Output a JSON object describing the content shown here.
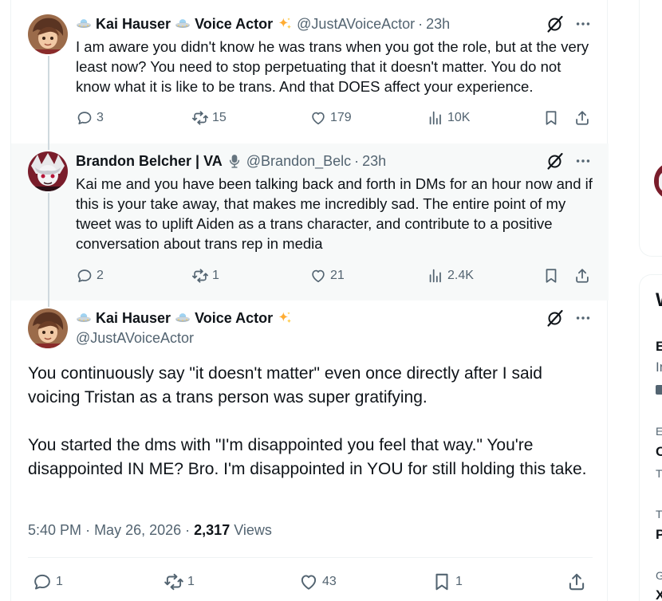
{
  "tweets": [
    {
      "display_name": "Kai Hauser",
      "badge": "Voice Actor",
      "handle": "@JustAVoiceActor",
      "time": "23h",
      "text": "I am aware you didn't know he was trans when you got the role, but at the very least now? You need to stop perpetuating that it doesn't matter. You do not know what it is like to be trans. And that DOES affect your experience.",
      "replies": "3",
      "reposts": "15",
      "likes": "179",
      "views": "10K"
    },
    {
      "display_name": "Brandon Belcher | VA",
      "handle": "@Brandon_Belc",
      "time": "23h",
      "text": "Kai me and you have been talking back and forth in DMs for an hour now and if this is your take away, that makes me incredibly sad. The entire point of my tweet was to uplift Aiden as a trans character, and contribute to a positive conversation about trans rep in media",
      "replies": "2",
      "reposts": "1",
      "likes": "21",
      "views": "2.4K"
    }
  ],
  "main_tweet": {
    "display_name": "Kai Hauser",
    "badge": "Voice Actor",
    "handle": "@JustAVoiceActor",
    "paragraph1": "You continuously say \"it doesn't matter\" even once directly after I said voicing Tristan as a trans person was super gratifying.",
    "paragraph2": "You started the dms with \"I'm disappointed you feel that way.\" You're disappointed IN ME? Bro. I'm disappointed in YOU for still holding this take.",
    "time": "5:40 PM",
    "date": "May 26, 2026",
    "views_count": "2,317",
    "views_label": "Views",
    "replies": "1",
    "reposts": "1",
    "likes": "43",
    "bookmarks": "1"
  },
  "sidebar": {
    "heading_fragment": "W",
    "items": [
      {
        "line1": "E",
        "line2": "In"
      },
      {
        "line1": "E",
        "line2": "C",
        "line3": "T"
      },
      {
        "line1": "T",
        "line2": "P"
      },
      {
        "line1": "G",
        "line2": "X"
      }
    ]
  },
  "colors": {
    "text": "#0f1419",
    "muted": "#536471",
    "highlight_bg": "#f7f9f9",
    "thread_line": "#cfd9de",
    "border": "#eff3f4"
  },
  "icons": [
    "reply-icon",
    "repost-icon",
    "like-icon",
    "views-icon",
    "bookmark-icon",
    "share-icon",
    "grok-icon",
    "more-icon",
    "ufo-emoji",
    "sparkles-emoji",
    "microphone-emoji"
  ]
}
